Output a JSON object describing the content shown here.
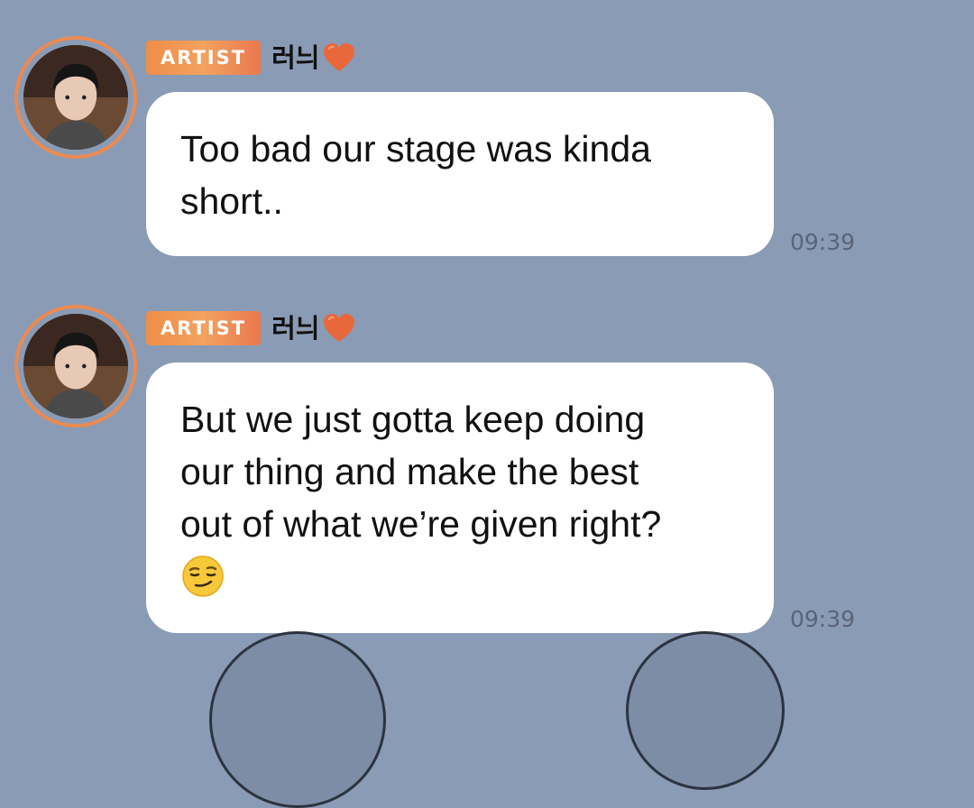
{
  "messages": [
    {
      "badge": "ARTIST",
      "sender": "러늬",
      "lines": [
        "Too bad our stage was kinda",
        "short.."
      ],
      "time": "09:39",
      "emoji": ""
    },
    {
      "badge": "ARTIST",
      "sender": "러늬",
      "lines": [
        "But we just gotta keep doing",
        "our thing and make the best",
        "out of what we’re given right?"
      ],
      "time": "09:39",
      "emoji": "smirk-emoji"
    }
  ],
  "colors": {
    "background": "#8a9bb5",
    "badge": "#ee8d48",
    "bubble": "#ffffff",
    "heart": "#e8683c",
    "avatar_ring": "#ea8a52"
  },
  "icons": {
    "sender_icon": "orange-heart-icon",
    "reaction_emoji": "smirking-face-icon"
  }
}
